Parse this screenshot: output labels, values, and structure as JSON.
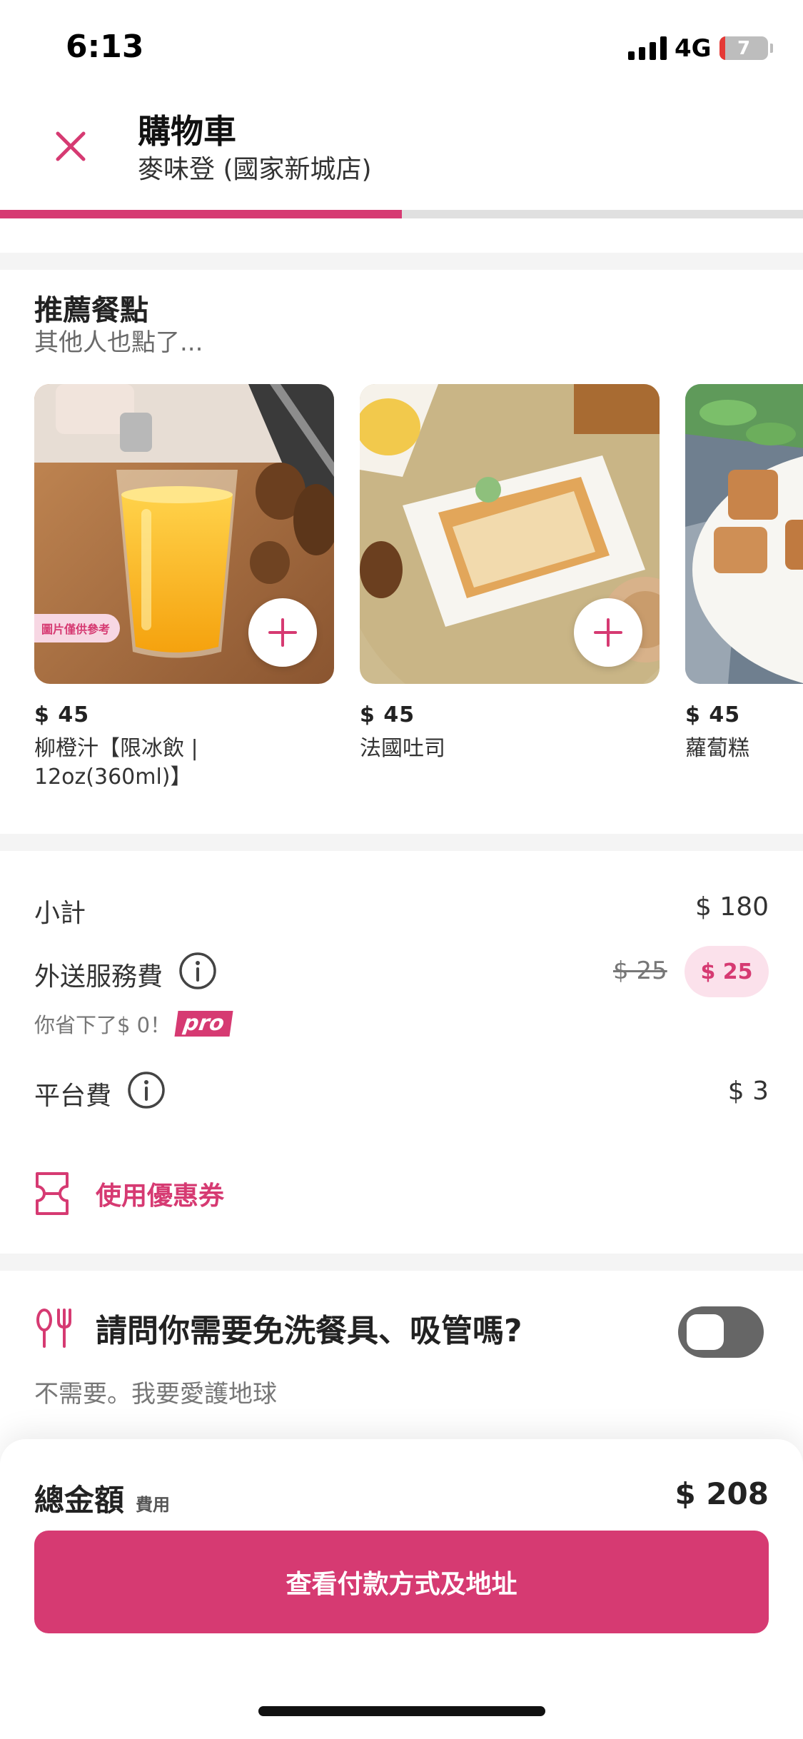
{
  "status_bar": {
    "time": "6:13",
    "network": "4G",
    "battery_level": "7"
  },
  "header": {
    "title": "購物車",
    "subtitle": "麥味登 (國家新城店)",
    "close_icon": "close-icon",
    "progress_fraction": 0.5
  },
  "recommended": {
    "title": "推薦餐點",
    "subtitle": "其他人也點了...",
    "items": [
      {
        "price": "$ 45",
        "name": "柳橙汁【限冰飲 | 12oz(360ml)】",
        "tag": "圖片僅供參考"
      },
      {
        "price": "$ 45",
        "name": "法國吐司"
      },
      {
        "price": "$ 45",
        "name": "蘿蔔糕"
      }
    ]
  },
  "summary": {
    "subtotal_label": "小計",
    "subtotal_value": "$ 180",
    "delivery_label": "外送服務費",
    "delivery_old": "$ 25",
    "delivery_value": "$ 25",
    "saved_text": "你省下了$ 0！",
    "pro_label": "pro",
    "platform_label": "平台費",
    "platform_value": "$ 3",
    "voucher_label": "使用優惠券"
  },
  "cutlery": {
    "question": "請問你需要免洗餐具、吸管嗎?",
    "subtext": "不需要。我要愛護地球",
    "toggle_on": false
  },
  "checkout": {
    "total_label": "總金額",
    "total_note": "費用",
    "total_value": "$ 208",
    "button_label": "查看付款方式及地址"
  },
  "colors": {
    "accent": "#d63a72",
    "accent_light": "#fbe1eb"
  }
}
